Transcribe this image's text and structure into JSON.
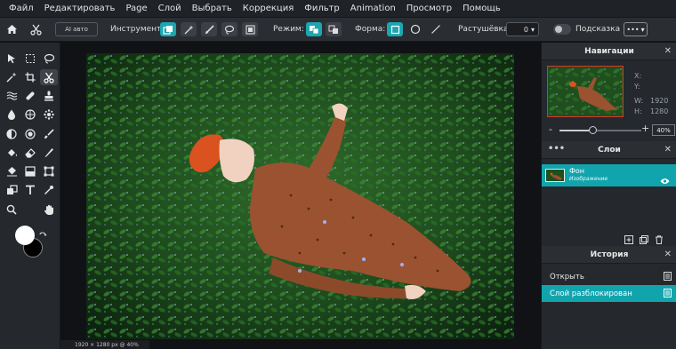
{
  "menu": [
    "Файл",
    "Редактировать",
    "Page",
    "Слой",
    "Выбрать",
    "Коррекция",
    "Фильтр",
    "Animation",
    "Просмотр",
    "Помощь"
  ],
  "options": {
    "ai_label": "AI авто",
    "instrument_label": "Инструмент:",
    "mode_label": "Режим:",
    "form_label": "Форма:",
    "feather_label": "Растушёвка:",
    "feather_value": "0",
    "hint_label": "Подсказка",
    "more_label": "•••"
  },
  "status": {
    "text": "1920 × 1280 px @ 40%"
  },
  "navigation": {
    "title": "Навигации",
    "x_label": "X:",
    "y_label": "Y:",
    "w_label": "W:",
    "w_value": "1920",
    "h_label": "H:",
    "h_value": "1280",
    "zoom_value": "40%",
    "zoom_level": 0.4
  },
  "layers": {
    "title": "Слои",
    "items": [
      {
        "name": "Фон",
        "subtitle": "Изображение"
      }
    ]
  },
  "history": {
    "title": "История",
    "items": [
      {
        "label": "Открыть",
        "active": false
      },
      {
        "label": "Слой разблокирован",
        "active": true
      }
    ]
  },
  "colors": {
    "accent": "#1ba6b0",
    "foreground": "#ffffff",
    "background": "#000000"
  },
  "tools": [
    "move-icon",
    "marquee-icon",
    "lasso-icon",
    "magic-wand-icon",
    "crop-icon",
    "scissors-icon",
    "liquify-icon",
    "healing-icon",
    "clone-stamp-icon",
    "blur-icon",
    "sponge-icon",
    "dodge-icon",
    "burn-icon",
    "sphere-icon",
    "brush-icon",
    "fill-icon",
    "eraser-icon",
    "pencil-icon",
    "bucket-icon",
    "gradient-icon",
    "rect-shape-icon",
    "stamp-icon",
    "text-icon",
    "eyedropper-icon",
    "zoom-icon",
    "hand-icon"
  ]
}
